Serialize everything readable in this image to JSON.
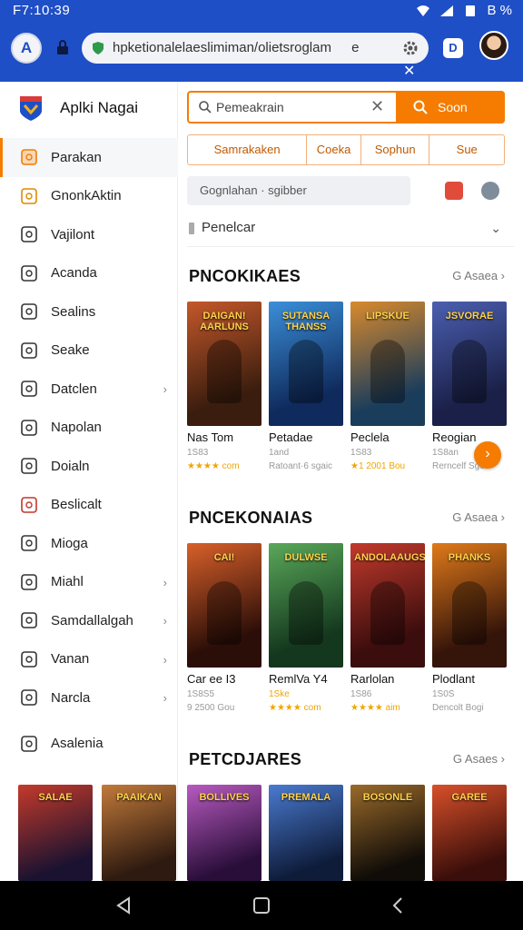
{
  "status": {
    "time": "F7:10:39",
    "battery": "B %"
  },
  "browser": {
    "profile_letter": "A",
    "url": "hpketionalelaeslimiman/olietsroglam",
    "url_suffix": "e",
    "tab_count": "D",
    "close_glyph": "✕"
  },
  "sidebar": {
    "app_name": "Aplki Nagai",
    "items": [
      {
        "label": "Parakan",
        "icon": "bag-icon",
        "active": true,
        "chevron": false
      },
      {
        "label": "GnonkAktin",
        "icon": "megaphone-icon",
        "active": false,
        "chevron": false
      },
      {
        "label": "Vajilont",
        "icon": "device-icon",
        "active": false,
        "chevron": false
      },
      {
        "label": "Acanda",
        "icon": "dice-icon",
        "active": false,
        "chevron": false
      },
      {
        "label": "Sealins",
        "icon": "person-icon",
        "active": false,
        "chevron": false
      },
      {
        "label": "Seake",
        "icon": "compass-icon",
        "active": false,
        "chevron": false
      },
      {
        "label": "Datclen",
        "icon": "shield-icon",
        "active": false,
        "chevron": true
      },
      {
        "label": "Napolan",
        "icon": "image-icon",
        "active": false,
        "chevron": false
      },
      {
        "label": "Doialn",
        "icon": "sp-icon",
        "active": false,
        "chevron": false
      },
      {
        "label": "Beslicalt",
        "icon": "envelope-icon",
        "active": false,
        "chevron": false
      },
      {
        "label": "Mioga",
        "icon": "grid-icon",
        "active": false,
        "chevron": false
      },
      {
        "label": "Miahl",
        "icon": "tablet-icon",
        "active": false,
        "chevron": true
      },
      {
        "label": "Samdallalgah",
        "icon": "user-icon",
        "active": false,
        "chevron": true
      },
      {
        "label": "Vanan",
        "icon": "flag-icon",
        "active": false,
        "chevron": true
      },
      {
        "label": "Narcla",
        "icon": "puzzle-icon",
        "active": false,
        "chevron": true
      },
      {
        "label": "Asalenia",
        "icon": "checkbox-icon",
        "active": false,
        "chevron": false
      }
    ],
    "chevron_glyph": "›"
  },
  "search": {
    "value": "Pemeakrain",
    "clear_glyph": "✕",
    "button_label": "Soon"
  },
  "filters": [
    "Samrakaken",
    "Coeka",
    "Sophun",
    "Sue"
  ],
  "sort": {
    "label": "Gognlahan · sgibber"
  },
  "dropdown": {
    "label": "Penelcar",
    "chevron": "⌄"
  },
  "sections": [
    {
      "title": "PNCOKIKAES",
      "see_all": "G Asaea  ›",
      "cards": [
        {
          "name": "Nas Tom",
          "meta": "1S83",
          "rating": "★★★★ com",
          "poster_title": "DAIGAN! AARLUNS",
          "poster_colors": [
            "#3a1d0e",
            "#c4582a"
          ]
        },
        {
          "name": "Petadae",
          "meta": "1and",
          "rating": "Ratoant·6 sgaic",
          "poster_title": "SUTANSA THANSS",
          "poster_colors": [
            "#0f2a5c",
            "#3b8fd9"
          ]
        },
        {
          "name": "Peclela",
          "meta": "1S83",
          "rating": "★1 2001 Bou",
          "poster_title": "LIPSKUE",
          "poster_colors": [
            "#1b3d5c",
            "#d98a2c"
          ]
        },
        {
          "name": "Reogian",
          "meta": "1S8an",
          "rating": "Rerncelf Sgo",
          "poster_title": "JSVORAE",
          "poster_colors": [
            "#1a2048",
            "#4b5fb0"
          ]
        }
      ]
    },
    {
      "title": "PNCEKONAIAS",
      "see_all": "G Asaea  ›",
      "cards": [
        {
          "name": "Car ee I3",
          "meta": "1S8S5",
          "rating": "9 2500 Gou",
          "poster_title": "CAI!",
          "poster_colors": [
            "#2c0e08",
            "#d8602a"
          ]
        },
        {
          "name": "RemlVa Y4",
          "meta": "1Ske",
          "rating": "★★★★ com",
          "poster_title": "DULWSE",
          "poster_colors": [
            "#14381e",
            "#5aa85a"
          ]
        },
        {
          "name": "Rarlolan",
          "meta": "1S86",
          "rating": "★★★★ aim",
          "poster_title": "ANDOLAAUGS",
          "poster_colors": [
            "#3b0d0d",
            "#c23a2c"
          ]
        },
        {
          "name": "Plodlant",
          "meta": "1S0S",
          "rating": "Dencolt Bogi",
          "poster_title": "PHANKS",
          "poster_colors": [
            "#35140a",
            "#e07a1a"
          ]
        }
      ]
    },
    {
      "title": "PETCDJARES",
      "see_all": "G Asaes  ›"
    }
  ],
  "bottom_posters": [
    {
      "title": "SALAE",
      "colors": [
        "#1a1230",
        "#c43a2a"
      ]
    },
    {
      "title": "PAAIKAN",
      "colors": [
        "#2e1a10",
        "#c27a3a"
      ]
    },
    {
      "title": "BOLLIVES",
      "colors": [
        "#2a0e3a",
        "#b85ac0"
      ]
    },
    {
      "title": "PREMALA",
      "colors": [
        "#0e1c3a",
        "#4a7ad0"
      ]
    },
    {
      "title": "BOSONLE",
      "colors": [
        "#100c08",
        "#9a6a2a"
      ]
    },
    {
      "title": "GAREE",
      "colors": [
        "#3a0e0a",
        "#d8502a"
      ]
    }
  ],
  "colors": {
    "accent": "#f57c00",
    "browser_bar": "#1f4fc7",
    "star": "#f0a500"
  },
  "next_glyph": "›"
}
